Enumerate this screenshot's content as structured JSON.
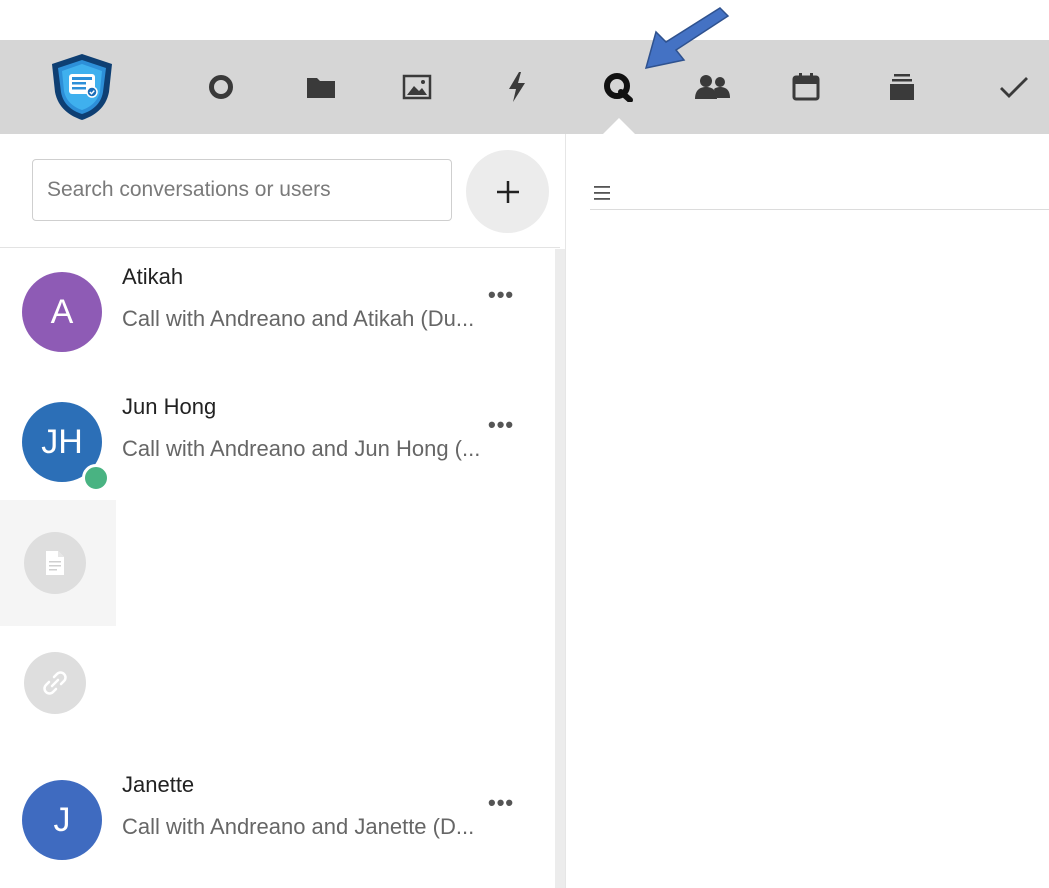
{
  "nav": {
    "accent": "#2c6fb7",
    "active_tab": "talk",
    "items": [
      {
        "name": "dashboard-icon",
        "color": "#3a3a3a"
      },
      {
        "name": "files-icon",
        "color": "#3a3a3a"
      },
      {
        "name": "photos-icon",
        "color": "#3a3a3a"
      },
      {
        "name": "activity-icon",
        "color": "#3a3a3a"
      },
      {
        "name": "talk-icon",
        "color": "#111111"
      },
      {
        "name": "contacts-icon",
        "color": "#3a3a3a"
      },
      {
        "name": "calendar-icon",
        "color": "#3a3a3a"
      },
      {
        "name": "deck-icon",
        "color": "#3a3a3a"
      },
      {
        "name": "tasks-icon",
        "color": "#3a3a3a"
      }
    ]
  },
  "annotation": {
    "arrow_color": "#4472c4",
    "points_to": "talk-icon"
  },
  "search": {
    "placeholder": "Search conversations or users",
    "value": ""
  },
  "new_conversation": {
    "label": "+"
  },
  "conversations": [
    {
      "initials": "A",
      "name": "Atikah",
      "subtitle": "Call with Andreano and Atikah (Du...",
      "color": "#8e5bb5",
      "online": false
    },
    {
      "initials": "JH",
      "name": "Jun Hong",
      "subtitle": "Call with Andreano and Jun Hong (...",
      "color": "#2c6fb7",
      "online": true
    },
    {
      "initials": "J",
      "name": "Janette",
      "subtitle": "Call with Andreano and Janette (D...",
      "color": "#3f6bc0",
      "online": false
    }
  ],
  "more_label": "•••",
  "placeholders": [
    {
      "name": "document-icon"
    },
    {
      "name": "link-icon"
    }
  ]
}
